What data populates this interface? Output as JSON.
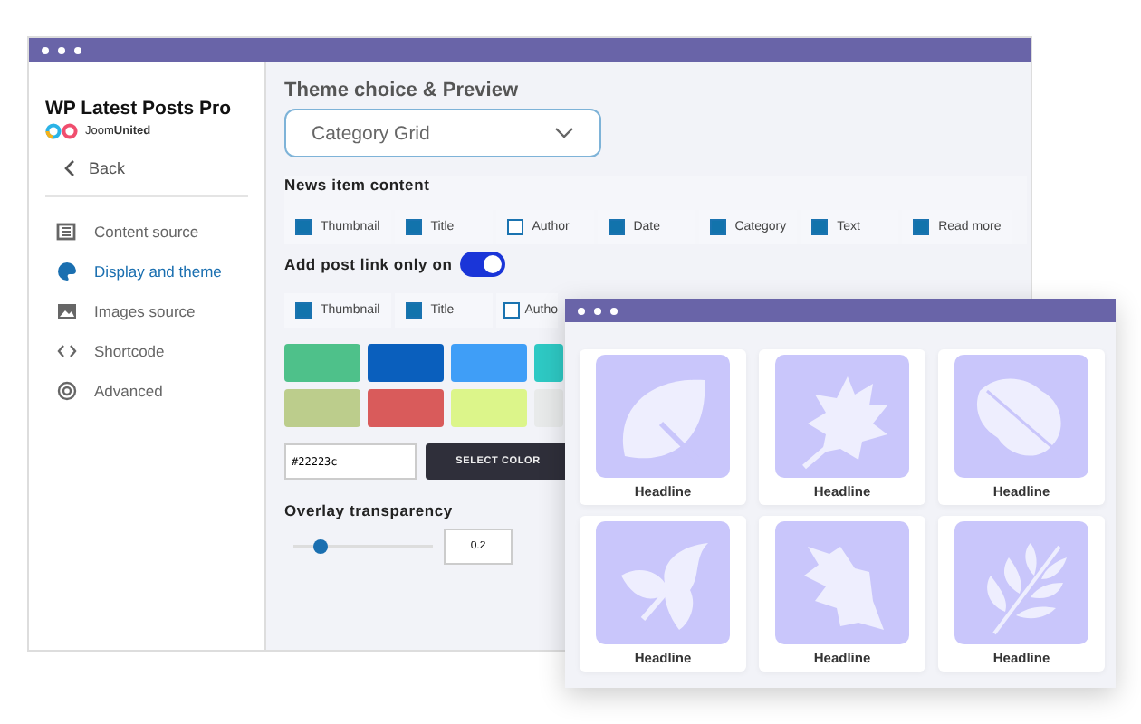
{
  "main_window": {
    "sidebar": {
      "title": "WP Latest Posts Pro",
      "brand": "Joom**United**",
      "back": "Back",
      "items": [
        {
          "label": "Content source",
          "selected": false
        },
        {
          "label": "Display and theme",
          "selected": true
        },
        {
          "label": "Images source",
          "selected": false
        },
        {
          "label": "Shortcode",
          "selected": false
        },
        {
          "label": "Advanced",
          "selected": false
        }
      ]
    },
    "content": {
      "heading": "Theme choice & Preview",
      "theme_select": {
        "value": "Category Grid"
      },
      "news_item_content": {
        "label": "News item content",
        "options": [
          {
            "label": "Thumbnail",
            "checked": true
          },
          {
            "label": "Title",
            "checked": true
          },
          {
            "label": "Author",
            "checked": false
          },
          {
            "label": "Date",
            "checked": true
          },
          {
            "label": "Category",
            "checked": true
          },
          {
            "label": "Text",
            "checked": true
          },
          {
            "label": "Read more",
            "checked": true
          }
        ]
      },
      "post_link": {
        "label": "Add post link only on",
        "on": true,
        "options": [
          {
            "label": "Thumbnail",
            "checked": true
          },
          {
            "label": "Title",
            "checked": true
          },
          {
            "label": "Autho",
            "checked": false
          }
        ]
      },
      "swatches": [
        {
          "color": "#4ec18a"
        },
        {
          "color": "#0a5fbd"
        },
        {
          "color": "#3f9ef7"
        },
        {
          "color": "#2ec9c4"
        },
        {
          "color": "#bccd8c"
        },
        {
          "color": "#d95b5b"
        },
        {
          "color": "#dcf58a"
        },
        {
          "color": "#e8eaea"
        }
      ],
      "color_field": {
        "value": "#22223c"
      },
      "select_color_button": "SELECT COLOR",
      "overlay_transparency": {
        "label": "Overlay transparency",
        "level": 0.2,
        "value": "0.2"
      }
    }
  },
  "preview_window": {
    "cards": [
      {
        "headline": "Headline"
      },
      {
        "headline": "Headline"
      },
      {
        "headline": "Headline"
      },
      {
        "headline": "Headline"
      },
      {
        "headline": "Headline"
      },
      {
        "headline": "Headline"
      }
    ]
  }
}
